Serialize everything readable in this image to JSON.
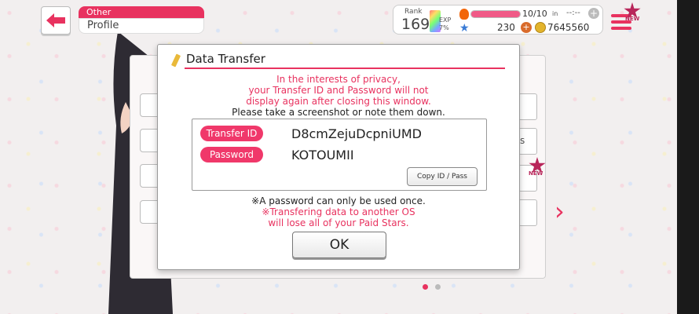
{
  "header": {
    "category": "Other",
    "page": "Profile",
    "back_icon": "back-arrow-icon"
  },
  "status": {
    "rank_label": "Rank",
    "rank_value": "169",
    "exp_label": "EXP",
    "exp_percent": "7%",
    "lp_value": "10/10",
    "lp_in_label": "in",
    "lp_timer": "--:--",
    "lp_fraction": 1.0,
    "stars_value": "230",
    "coins_value": "7645560",
    "new_badge": "NEW"
  },
  "background": {
    "right_partial_text": "s",
    "new_badge": "NEW"
  },
  "modal": {
    "title": "Data Transfer",
    "warning_lines": [
      "In the interests of privacy,",
      "your Transfer ID and Password will not",
      "display again after closing this window."
    ],
    "instruction": "Please take a screenshot or note them down.",
    "transfer_id_label": "Transfer ID",
    "transfer_id_value": "D8cmZejuDcpniUMD",
    "password_label": "Password",
    "password_value": "KOTOUMII",
    "copy_button": "Copy ID / Pass",
    "note_once": "※A password can only be used once.",
    "note_os_lines": [
      "※Transfering data to another OS",
      "will lose all of your Paid Stars."
    ],
    "ok_button": "OK"
  },
  "colors": {
    "accent": "#e8325f",
    "pill": "#f0386a"
  }
}
